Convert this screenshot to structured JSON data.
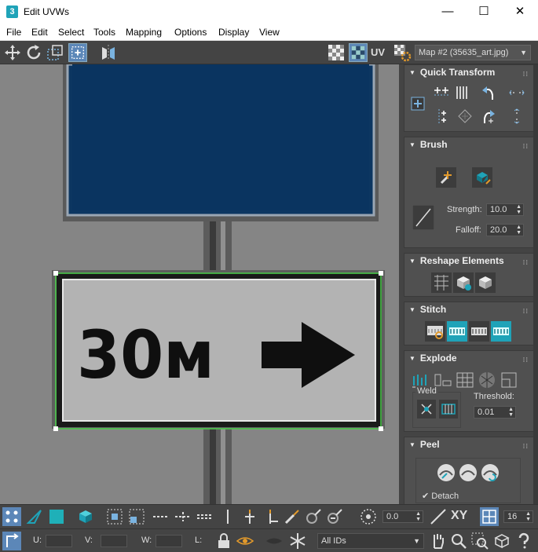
{
  "window": {
    "title": "Edit UVWs",
    "app_icon_label": "3",
    "minimize": "—",
    "maximize": "☐",
    "close": "✕"
  },
  "menu": {
    "items": [
      "File",
      "Edit",
      "Select",
      "Tools",
      "Mapping",
      "Options",
      "Display",
      "View"
    ]
  },
  "toolbar": {
    "uv_label": "UV",
    "map_dropdown": "Map #2 (35635_art.jpg)"
  },
  "sign": {
    "speed_text": "30м"
  },
  "panels": {
    "quick_transform": {
      "title": "Quick Transform"
    },
    "brush": {
      "title": "Brush",
      "strength_label": "Strength:",
      "strength_value": "10.0",
      "falloff_label": "Falloff:",
      "falloff_value": "20.0"
    },
    "reshape": {
      "title": "Reshape Elements"
    },
    "stitch": {
      "title": "Stitch"
    },
    "explode": {
      "title": "Explode",
      "weld_label": "Weld",
      "threshold_label": "Threshold:",
      "threshold_value": "0.01"
    },
    "peel": {
      "title": "Peel",
      "detach_label": "Detach"
    }
  },
  "bottombar": {
    "rotate_value": "0.0",
    "xy_label": "XY",
    "grid_value": "16",
    "u_label": "U:",
    "v_label": "V:",
    "w_label": "W:",
    "l_label": "L:",
    "ids_dropdown": "All IDs"
  },
  "colors": {
    "accent": "#5c87b8",
    "selection_green": "#4ad04a",
    "sign_blue": "#0a3a6a",
    "teal": "#1fa3b8"
  }
}
